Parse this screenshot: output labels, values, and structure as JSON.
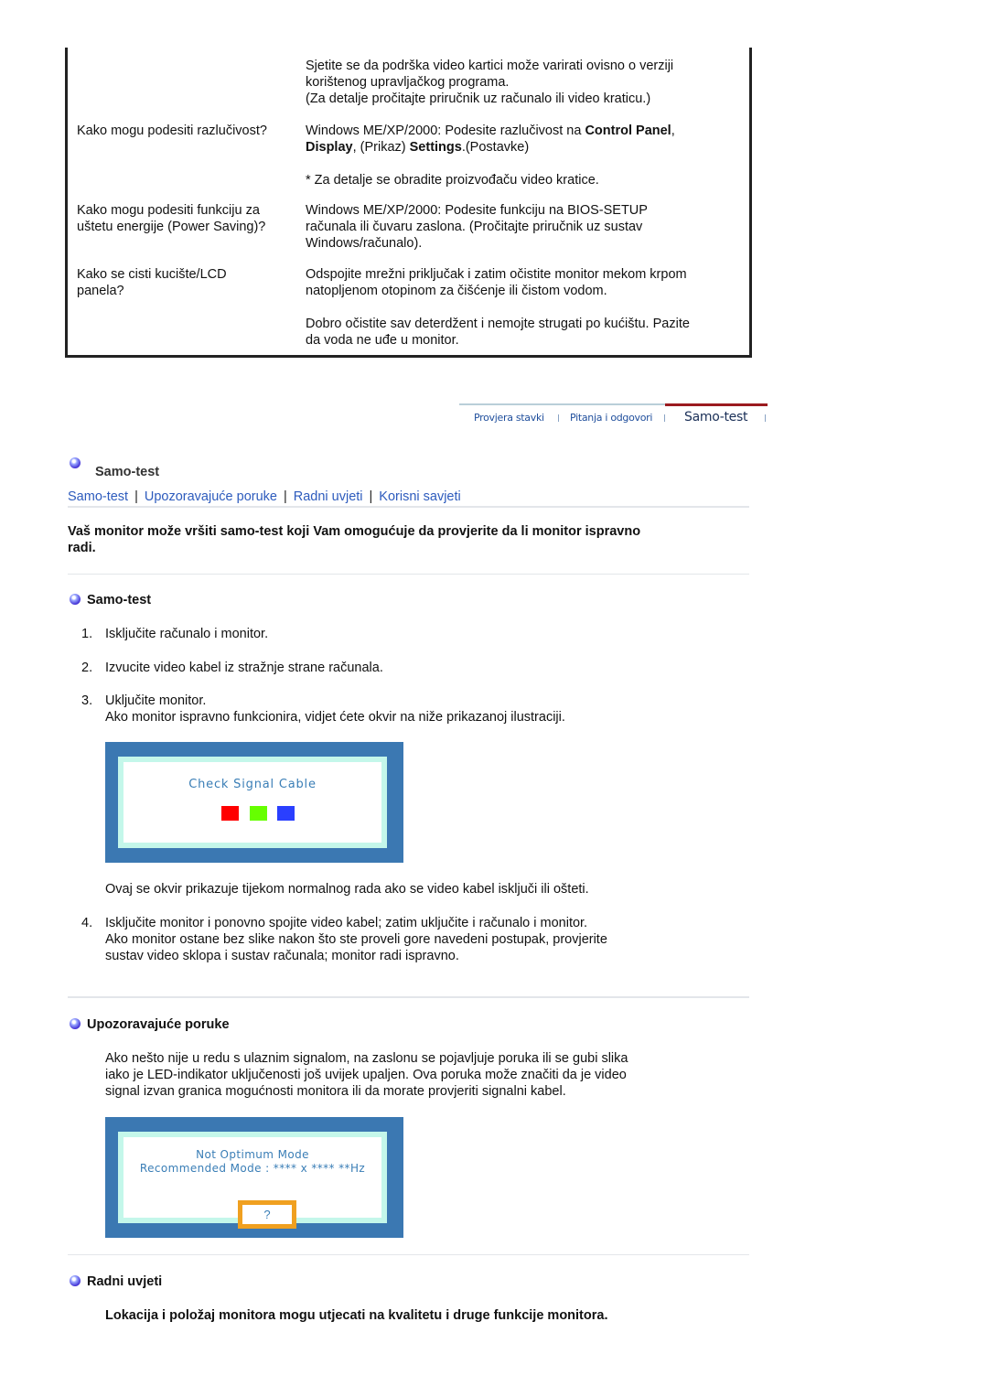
{
  "faq": {
    "rows": [
      {
        "question": "",
        "answer_lines": [
          "Sjetite se da podrška video kartici može varirati ovisno o verziji",
          "korištenog upravljačkog programa.",
          "(Za detalje pročitajte priručnik uz računalo ili video kraticu.)"
        ]
      },
      {
        "question": "Kako mogu podesiti razlučivost?",
        "answer_prefix": "Windows ME/XP/2000: Podesite razlučivost na ",
        "answer_bold1": "Control Panel",
        "answer_sep1": ",",
        "answer_bold2": "Display",
        "answer_mid": ", (Prikaz) ",
        "answer_bold3": "Settings",
        "answer_suffix": ".(Postavke)",
        "note": "* Za detalje se obradite proizvođaču video kratice."
      },
      {
        "question_lines": [
          "Kako mogu podesiti funkciju za",
          "uštetu energije (Power Saving)?"
        ],
        "answer_lines": [
          "Windows ME/XP/2000: Podesite funkciju na BIOS-SETUP",
          "računala ili čuvaru zaslona. (Pročitajte priručnik uz sustav",
          "Windows/računalo)."
        ]
      },
      {
        "question_lines": [
          "Kako se cisti kucište/LCD",
          "panela?"
        ],
        "answer_lines": [
          "Odspojite mrežni priključak i zatim očistite monitor mekom krpom",
          "natopljenom otopinom za čišćenje ili čistom vodom."
        ],
        "answer2_lines": [
          "Dobro očistite sav deterdžent i nemojte strugati po kućištu. Pazite",
          "da voda ne uđe u monitor."
        ]
      }
    ]
  },
  "tabnav": {
    "tabs": [
      {
        "label": "Provjera stavki",
        "active": false
      },
      {
        "label": "Pitanja i odgovori",
        "active": false
      },
      {
        "label": "Samo-test",
        "active": true
      }
    ],
    "active_color": "#9b1b1f"
  },
  "page": {
    "title": "Samo-test",
    "bullet_icon": "blue-orb-bullet",
    "nav_links": [
      "Samo-test",
      "Upozoravajuće poruke",
      "Radni uvjeti",
      "Korisni savjeti"
    ],
    "nav_separator": "|",
    "intro_lines": [
      "Vaš monitor može vršiti samo-test koji Vam omogućuje da provjerite da li monitor ispravno",
      "radi."
    ],
    "link_color": "#2d5bbd"
  },
  "selftest": {
    "heading": "Samo-test",
    "steps": [
      {
        "num": "1.",
        "lines": [
          "Isključite računalo i monitor."
        ]
      },
      {
        "num": "2.",
        "lines": [
          "Izvucite video kabel iz stražnje strane računala."
        ]
      },
      {
        "num": "3.",
        "lines": [
          "Uključite monitor.",
          "Ako monitor ispravno funkcionira, vidjet ćete okvir na niže prikazanoj ilustraciji."
        ]
      },
      {
        "num": "4.",
        "lines": [
          "Isključite monitor i ponovno spojite video kabel; zatim uključite i računalo i monitor.",
          "Ako monitor ostane bez slike nakon što ste proveli gore navedeni postupak, provjerite",
          "sustav video sklopa i sustav računala; monitor radi ispravno."
        ]
      }
    ],
    "osd_message": "Check Signal Cable",
    "osd_colors": [
      "#ff0000",
      "#66ff00",
      "#2a3fff"
    ],
    "after_image_text": "Ovaj se okvir prikazuje tijekom normalnog rada ako se video kabel isključi ili ošteti."
  },
  "warnings": {
    "heading": "Upozoravajuće poruke",
    "lines": [
      "Ako nešto nije u redu s ulaznim signalom, na zaslonu se pojavljuje poruka ili se gubi slika",
      "iako je LED-indikator uključenosti još uvijek upaljen. Ova poruka može značiti da je video",
      "signal izvan granica mogućnosti monitora ili da morate provjeriti signalni kabel."
    ],
    "osd_line1": "Not Optimum Mode",
    "osd_line2": "Recommended Mode : **** x ****  **Hz",
    "osd_button": "?"
  },
  "conditions": {
    "heading": "Radni uvjeti",
    "text": "Lokacija i položaj monitora mogu utjecati na kvalitetu i druge funkcije monitora."
  }
}
